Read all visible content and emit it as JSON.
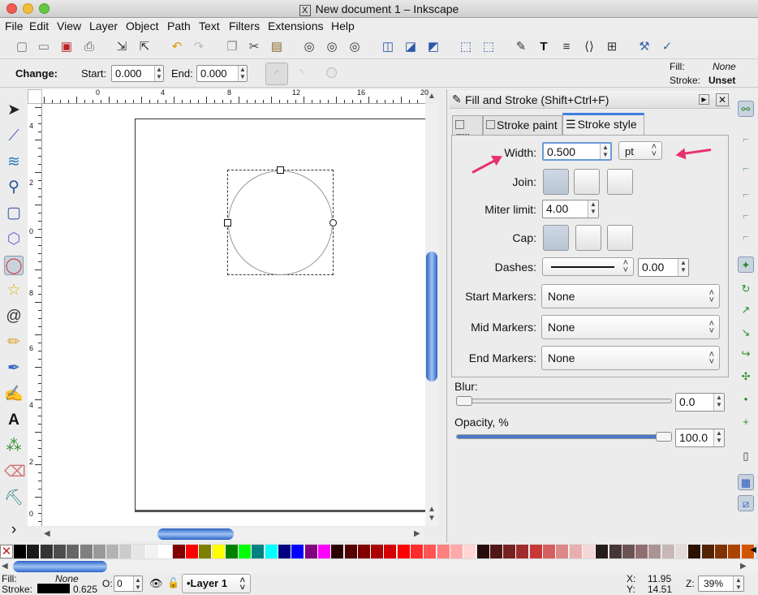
{
  "window": {
    "title": "New document 1 – Inkscape"
  },
  "menu": {
    "items": [
      "File",
      "Edit",
      "View",
      "Layer",
      "Object",
      "Path",
      "Text",
      "Filters",
      "Extensions",
      "Help"
    ]
  },
  "toolbar": {
    "icons": [
      "new-icon",
      "open-icon",
      "save-icon",
      "print-icon",
      "import-icon",
      "export-icon",
      "undo-icon",
      "redo-icon",
      "copy-icon",
      "cut-icon",
      "paste-icon",
      "zoom-selection-icon",
      "zoom-drawing-icon",
      "zoom-page-icon",
      "duplicate-icon",
      "clone-icon",
      "unlink-clone-icon",
      "group-icon",
      "ungroup-icon",
      "fill-stroke-icon",
      "text-font-icon",
      "layers-icon",
      "xml-editor-icon",
      "align-icon",
      "preferences-icon",
      "document-properties-icon"
    ]
  },
  "controls": {
    "change_label": "Change:",
    "start_label": "Start:",
    "start_value": "0.000",
    "end_label": "End:",
    "end_value": "0.000"
  },
  "style_indicator": {
    "fill_label": "Fill:",
    "fill_value": "None",
    "stroke_label": "Stroke:",
    "stroke_value": "Unset"
  },
  "tools": [
    "selector-tool-icon",
    "node-tool-icon",
    "tweak-tool-icon",
    "zoom-tool-icon",
    "rectangle-tool-icon",
    "3d-box-tool-icon",
    "ellipse-tool-icon",
    "star-tool-icon",
    "spiral-tool-icon",
    "pencil-tool-icon",
    "pen-tool-icon",
    "calligraphy-tool-icon",
    "text-tool-icon",
    "spray-tool-icon",
    "eraser-tool-icon",
    "paint-bucket-tool-icon",
    "more-tools-icon"
  ],
  "ruler": {
    "h_labels": [
      "0",
      "4",
      "8",
      "12",
      "16",
      "20"
    ],
    "v_labels": [
      "4",
      "2",
      "0",
      "8",
      "6",
      "4",
      "2",
      "0"
    ]
  },
  "panel": {
    "title": "Fill and Stroke (Shift+Ctrl+F)",
    "tabs": [
      "Fill",
      "Stroke paint",
      "Stroke style"
    ],
    "width_label": "Width:",
    "width_value": "0.500",
    "unit": "pt",
    "join_label": "Join:",
    "miter_label": "Miter limit:",
    "miter_value": "4.00",
    "cap_label": "Cap:",
    "dashes_label": "Dashes:",
    "dash_offset": "0.00",
    "start_markers_label": "Start Markers:",
    "start_markers_value": "None",
    "mid_markers_label": "Mid Markers:",
    "mid_markers_value": "None",
    "end_markers_label": "End Markers:",
    "end_markers_value": "None",
    "blur_label": "Blur:",
    "blur_value": "0.0",
    "opacity_label": "Opacity, %",
    "opacity_value": "100.0"
  },
  "snap_icons": [
    "snap-toggle-icon",
    "snap-bbox-icon",
    "snap-bbox-edge-icon",
    "snap-bbox-corner-icon",
    "snap-bbox-midpoint-icon",
    "snap-bbox-center-icon",
    "snap-nodes-icon",
    "snap-path-icon",
    "snap-intersection-icon",
    "snap-cusp-icon",
    "snap-smooth-icon",
    "snap-midpoint-icon",
    "snap-object-center-icon",
    "snap-rotation-center-icon",
    "snap-page-icon",
    "snap-grid-icon",
    "snap-guide-icon"
  ],
  "palette": {
    "colors": [
      "#000000",
      "#1a1a1a",
      "#333333",
      "#4d4d4d",
      "#666666",
      "#808080",
      "#999999",
      "#b3b3b3",
      "#cccccc",
      "#e6e6e6",
      "#f2f2f2",
      "#ffffff",
      "#800000",
      "#ff0000",
      "#808000",
      "#ffff00",
      "#008000",
      "#00ff00",
      "#008080",
      "#00ffff",
      "#000080",
      "#0000ff",
      "#800080",
      "#ff00ff",
      "#2b0000",
      "#550000",
      "#800000",
      "#aa0000",
      "#d40000",
      "#ff0000",
      "#ff2a2a",
      "#ff5555",
      "#ff8080",
      "#ffaaaa",
      "#ffd5d5",
      "#280b0b",
      "#501616",
      "#782121",
      "#a02c2c",
      "#c83737",
      "#d35f5f",
      "#de8787",
      "#e9afaf",
      "#f4d7d7",
      "#241c1c",
      "#483737",
      "#6c5353",
      "#916f6f",
      "#ac9393",
      "#c8b7b7",
      "#e3dbdb",
      "#2b1100",
      "#552200",
      "#803300",
      "#aa4400",
      "#d45500"
    ]
  },
  "status": {
    "fill_label": "Fill:",
    "fill_value": "None",
    "stroke_label": "Stroke:",
    "stroke_width": "0.625",
    "opacity_label": "O:",
    "opacity_value": "0",
    "layer_name": "•Layer 1",
    "x_label": "X:",
    "x_value": "11.95",
    "y_label": "Y:",
    "y_value": "14.51",
    "zoom_label": "Z:",
    "zoom_value": "39%"
  },
  "colors": {
    "accent": "#e8316e",
    "active_tool": "#c9d3e0"
  }
}
